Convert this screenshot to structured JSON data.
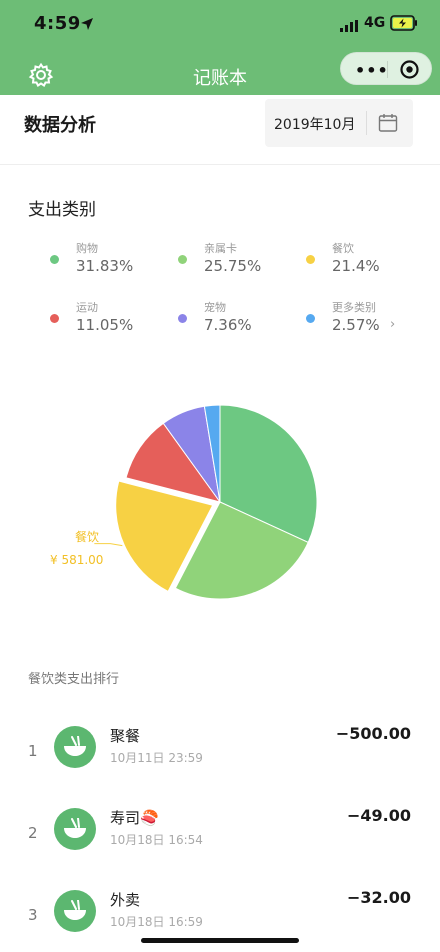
{
  "status_bar": {
    "time": "4:59",
    "network": "4G"
  },
  "navbar": {
    "title": "记账本",
    "more_glyph": "•••"
  },
  "header": {
    "page_title": "数据分析",
    "date": "2019年10月"
  },
  "categories": {
    "title": "支出类别",
    "items": [
      {
        "name": "购物",
        "percent": "31.83%",
        "color": "#6dc882"
      },
      {
        "name": "亲属卡",
        "percent": "25.75%",
        "color": "#90d37a"
      },
      {
        "name": "餐饮",
        "percent": "21.4%",
        "color": "#f7d144"
      },
      {
        "name": "运动",
        "percent": "11.05%",
        "color": "#e55f5a"
      },
      {
        "name": "宠物",
        "percent": "7.36%",
        "color": "#8b84e8"
      },
      {
        "name": "更多类别",
        "percent": "2.57%",
        "color": "#56a9f0",
        "chevron": "›"
      }
    ]
  },
  "chart_data": {
    "type": "pie",
    "slices": [
      {
        "label": "购物",
        "value": 31.83,
        "color": "#6dc882"
      },
      {
        "label": "亲属卡",
        "value": 25.75,
        "color": "#90d37a"
      },
      {
        "label": "餐饮",
        "value": 21.4,
        "color": "#f7d144",
        "highlighted": true
      },
      {
        "label": "运动",
        "value": 11.05,
        "color": "#e55f5a"
      },
      {
        "label": "宠物",
        "value": 7.36,
        "color": "#8b84e8"
      },
      {
        "label": "更多类别",
        "value": 2.57,
        "color": "#56a9f0"
      }
    ],
    "callout": {
      "label": "餐饮",
      "value": "¥ 581.00"
    }
  },
  "ranking": {
    "title": "餐饮类支出排行",
    "items": [
      {
        "rank": "1",
        "name": "聚餐",
        "time": "10月11日 23:59",
        "amount": "−500.00"
      },
      {
        "rank": "2",
        "name": "寿司🍣",
        "time": "10月18日 16:54",
        "amount": "−49.00"
      },
      {
        "rank": "3",
        "name": "外卖",
        "time": "10月18日 16:59",
        "amount": "−32.00"
      }
    ]
  },
  "colors": {
    "brand_green": "#6dbd76",
    "avatar_green": "#5cb770"
  }
}
